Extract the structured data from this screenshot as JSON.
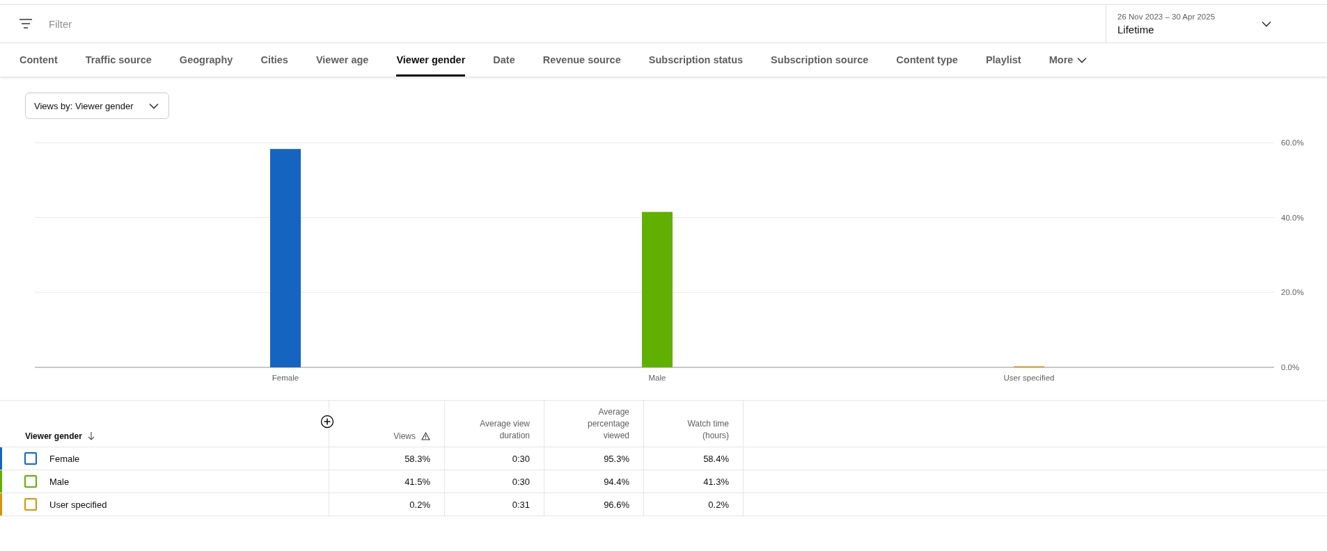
{
  "filter": {
    "placeholder": "Filter"
  },
  "date_range": {
    "range": "26 Nov 2023 – 30 Apr 2025",
    "period": "Lifetime"
  },
  "tabs": [
    {
      "label": "Content",
      "selected": false
    },
    {
      "label": "Traffic source",
      "selected": false
    },
    {
      "label": "Geography",
      "selected": false
    },
    {
      "label": "Cities",
      "selected": false
    },
    {
      "label": "Viewer age",
      "selected": false
    },
    {
      "label": "Viewer gender",
      "selected": true
    },
    {
      "label": "Date",
      "selected": false
    },
    {
      "label": "Revenue source",
      "selected": false
    },
    {
      "label": "Subscription status",
      "selected": false
    },
    {
      "label": "Subscription source",
      "selected": false
    },
    {
      "label": "Content type",
      "selected": false
    },
    {
      "label": "Playlist",
      "selected": false
    }
  ],
  "more_tab": {
    "label": "More"
  },
  "metric_dropdown": {
    "label": "Views by: Viewer gender"
  },
  "chart": {
    "chart_data": {
      "type": "bar",
      "categories": [
        "Female",
        "Male",
        "User specified"
      ],
      "values": [
        58.3,
        41.5,
        0.2
      ],
      "ylim": [
        0,
        60
      ],
      "yticks": [
        {
          "value": 0,
          "label": "0.0%"
        },
        {
          "value": 20,
          "label": "20.0%"
        },
        {
          "value": 40,
          "label": "40.0%"
        },
        {
          "value": 60,
          "label": "60.0%"
        }
      ]
    }
  },
  "table": {
    "columns": [
      "Viewer gender",
      "Views",
      "Average view duration",
      "Average percentage viewed",
      "Watch time (hours)"
    ],
    "rows": [
      {
        "color": "#1565c0",
        "checked": false,
        "cells": [
          "Female",
          "58.3%",
          "0:30",
          "95.3%",
          "58.4%"
        ]
      },
      {
        "color": "#5fb000",
        "checked": false,
        "cells": [
          "Male",
          "41.5%",
          "0:30",
          "94.4%",
          "41.3%"
        ]
      },
      {
        "color": "#d4950a",
        "checked": false,
        "cells": [
          "User specified",
          "0.2%",
          "0:31",
          "96.6%",
          "0.2%"
        ]
      }
    ]
  }
}
